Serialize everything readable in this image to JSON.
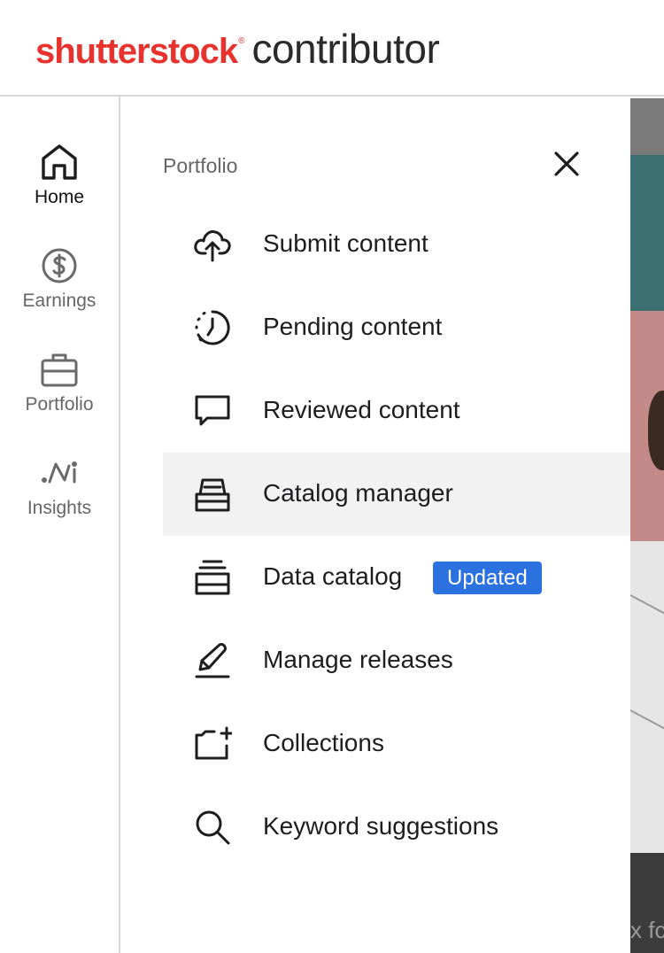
{
  "header": {
    "brand": "shutterstock",
    "registered": "®",
    "product": "contributor"
  },
  "rail": {
    "items": [
      {
        "label": "Home",
        "icon": "home-icon",
        "active": true
      },
      {
        "label": "Earnings",
        "icon": "dollar-icon",
        "active": false
      },
      {
        "label": "Portfolio",
        "icon": "briefcase-icon",
        "active": false
      },
      {
        "label": "Insights",
        "icon": "insights-icon",
        "active": false
      }
    ]
  },
  "drawer": {
    "title": "Portfolio",
    "close_icon": "close-icon",
    "items": [
      {
        "label": "Submit content",
        "icon": "cloud-upload-icon"
      },
      {
        "label": "Pending content",
        "icon": "pending-clock-icon"
      },
      {
        "label": "Reviewed content",
        "icon": "speech-bubble-icon"
      },
      {
        "label": "Catalog manager",
        "icon": "inbox-tray-icon",
        "highlighted": true
      },
      {
        "label": "Data catalog",
        "icon": "stacked-layers-icon",
        "badge": "Updated"
      },
      {
        "label": "Manage releases",
        "icon": "pen-signature-icon"
      },
      {
        "label": "Collections",
        "icon": "folder-plus-icon"
      },
      {
        "label": "Keyword suggestions",
        "icon": "search-icon"
      }
    ]
  },
  "background": {
    "partial_text": "x fc"
  },
  "colors": {
    "brand_red": "#e8322d",
    "badge_blue": "#2b71e0",
    "highlight_gray": "#f2f2f2"
  }
}
